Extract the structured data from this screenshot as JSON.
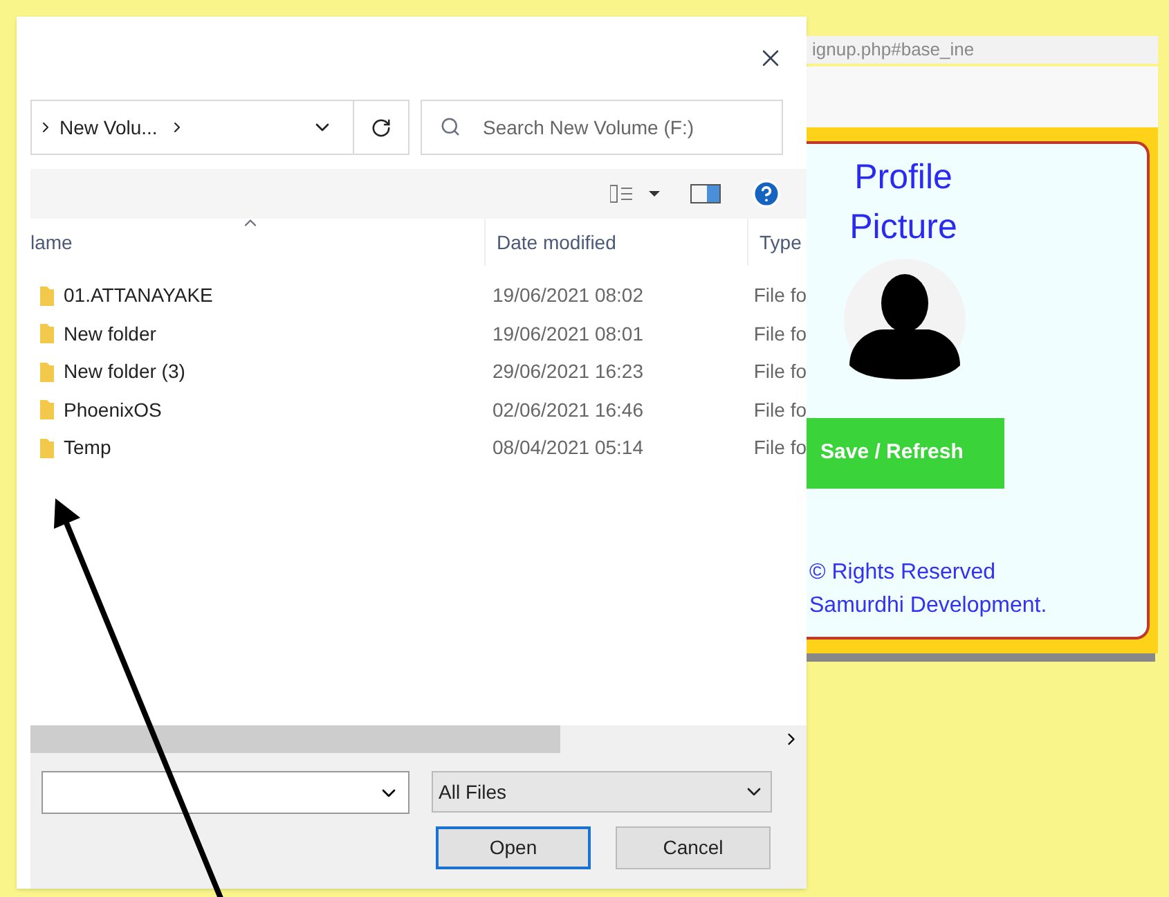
{
  "dialog": {
    "breadcrumb": "New Volu...",
    "search": {
      "placeholder": "Search New Volume (F:)"
    },
    "columns": [
      "lame",
      "Date modified",
      "Type"
    ],
    "rows": [
      {
        "name": "01.ATTANAYAKE",
        "date": "19/06/2021 08:02",
        "type": "File fo"
      },
      {
        "name": "New folder",
        "date": "19/06/2021 08:01",
        "type": "File fo"
      },
      {
        "name": "New folder (3)",
        "date": "29/06/2021 16:23",
        "type": "File fo"
      },
      {
        "name": "PhoenixOS",
        "date": "02/06/2021 16:46",
        "type": "File fo"
      },
      {
        "name": "Temp",
        "date": "08/04/2021 05:14",
        "type": "File fo"
      }
    ],
    "file_type": "All Files",
    "buttons": [
      "Open",
      "Cancel"
    ]
  },
  "browser": {
    "url": "ignup.php#base_ine",
    "title_lines": [
      "Profile",
      "Picture"
    ],
    "save_button": "Save / Refresh",
    "footer_lines": [
      "© Rights Reserved",
      "Samurdhi Development."
    ]
  }
}
